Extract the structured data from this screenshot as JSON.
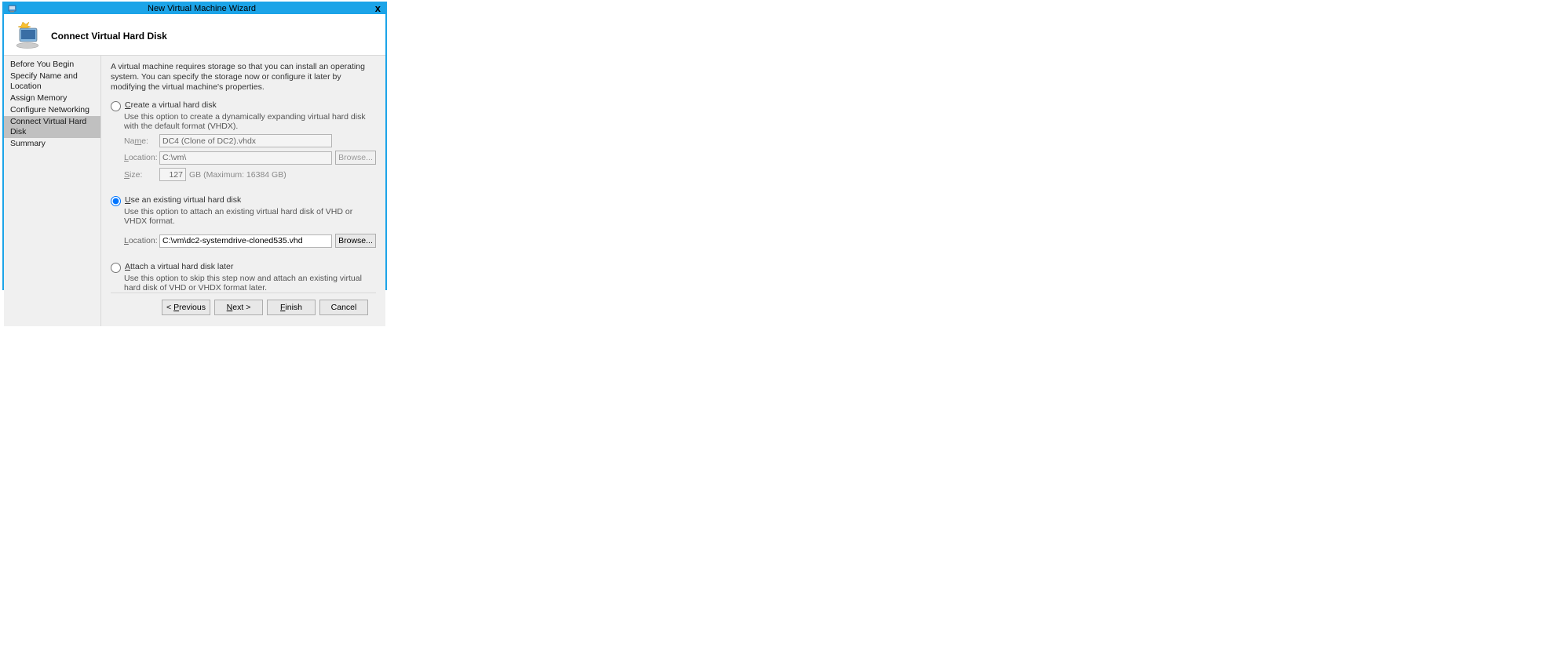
{
  "window": {
    "title": "New Virtual Machine Wizard",
    "close_label": "x"
  },
  "header": {
    "title": "Connect Virtual Hard Disk"
  },
  "sidebar": {
    "steps": [
      "Before You Begin",
      "Specify Name and Location",
      "Assign Memory",
      "Configure Networking",
      "Connect Virtual Hard Disk",
      "Summary"
    ],
    "active_index": 4
  },
  "intro": "A virtual machine requires storage so that you can install an operating system. You can specify the storage now or configure it later by modifying the virtual machine's properties.",
  "options": {
    "selected": "use_existing",
    "create": {
      "label_pre": "",
      "label_u": "C",
      "label_post": "reate a virtual hard disk",
      "desc": "Use this option to create a dynamically expanding virtual hard disk with the default format (VHDX).",
      "name_label_u": "m",
      "name_label_pre": "Na",
      "name_label_post": "e:",
      "name_value": "DC4 (Clone of DC2).vhdx",
      "loc_label_u": "L",
      "loc_label_post": "ocation:",
      "loc_value": "C:\\vm\\",
      "browse_label_u": "B",
      "browse_label_post": "rowse...",
      "size_label_u": "S",
      "size_label_post": "ize:",
      "size_value": "127",
      "size_suffix": "GB (Maximum: 16384 GB)"
    },
    "use_existing": {
      "label_u": "U",
      "label_post": "se an existing virtual hard disk",
      "desc": "Use this option to attach an existing virtual hard disk of VHD or VHDX format.",
      "loc_label_u": "L",
      "loc_label_post": "ocation:",
      "loc_value": "C:\\vm\\dc2-systemdrive-cloned535.vhd",
      "browse_label_u": "r",
      "browse_label_pre": "B",
      "browse_label_post": "owse..."
    },
    "attach_later": {
      "label_u": "A",
      "label_post": "ttach a virtual hard disk later",
      "desc": "Use this option to skip this step now and attach an existing virtual hard disk of VHD or VHDX format later."
    }
  },
  "footer": {
    "previous_pre": "< ",
    "previous_u": "P",
    "previous_post": "revious",
    "next_u": "N",
    "next_post": "ext >",
    "finish_u": "F",
    "finish_post": "inish",
    "cancel": "Cancel"
  }
}
